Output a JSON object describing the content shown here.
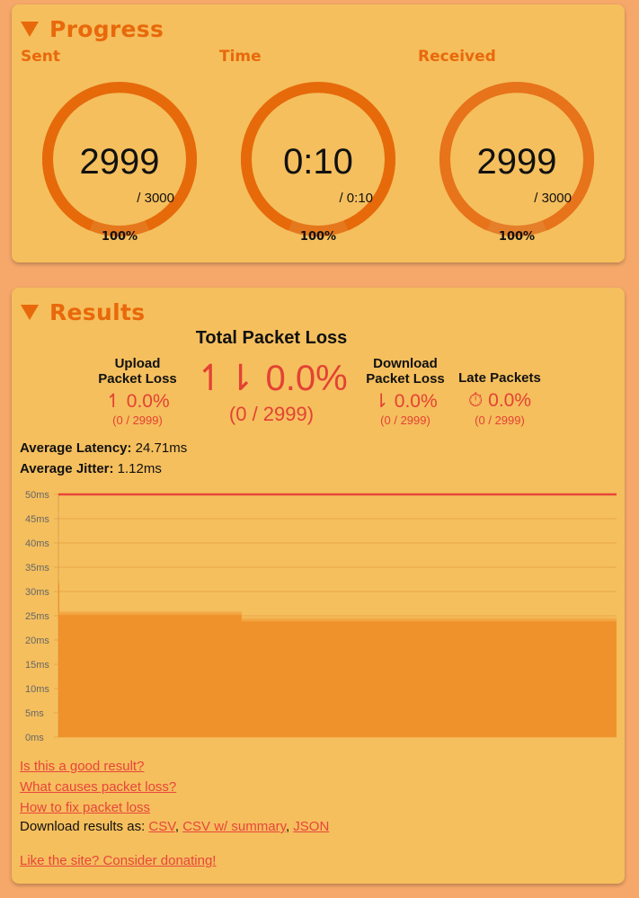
{
  "progress": {
    "title": "Progress",
    "gauges": [
      {
        "label": "Sent",
        "value": "2999",
        "total": "/ 3000",
        "percent": "100%",
        "fraction": 0.9997
      },
      {
        "label": "Time",
        "value": "0:10",
        "total": "/ 0:10",
        "percent": "100%",
        "fraction": 1.0
      },
      {
        "label": "Received",
        "value": "2999",
        "total": "/ 3000",
        "percent": "100%",
        "fraction": 0.9997
      }
    ]
  },
  "results": {
    "title": "Results",
    "total": {
      "title": "Total Packet Loss",
      "value": "↿⇂ 0.0%",
      "sub": "(0 / 2999)"
    },
    "upload": {
      "title1": "Upload",
      "title2": "Packet Loss",
      "value": "↿ 0.0%",
      "sub": "(0 / 2999)"
    },
    "download": {
      "title1": "Download",
      "title2": "Packet Loss",
      "value": "⇂ 0.0%",
      "sub": "(0 / 2999)"
    },
    "late": {
      "title": "Late Packets",
      "value": "⏱ 0.0%",
      "sub": "(0 / 2999)"
    },
    "latency_label": "Average Latency:",
    "latency_value": "24.71ms",
    "jitter_label": "Average Jitter:",
    "jitter_value": "1.12ms",
    "links": {
      "good_result": "Is this a good result?",
      "causes": "What causes packet loss?",
      "fix": "How to fix packet loss",
      "download_label": "Download results as:",
      "csv": "CSV",
      "csv_summary": "CSV w/ summary",
      "json": "JSON",
      "donate": "Like the site? Consider donating!"
    }
  },
  "colors": {
    "accent": "#e8690b",
    "loss": "#e34234",
    "bar": "#f0922b",
    "threshold": "#e8453c"
  },
  "chart_data": {
    "type": "area",
    "ylabel": "",
    "yticks": [
      "0ms",
      "5ms",
      "10ms",
      "15ms",
      "20ms",
      "25ms",
      "30ms",
      "35ms",
      "40ms",
      "45ms",
      "50ms"
    ],
    "ylim": [
      0,
      50
    ],
    "threshold_ms": 50,
    "packets": 2999,
    "segments": [
      {
        "from_packet": 0,
        "to_packet": 3,
        "latency_ms": 32
      },
      {
        "from_packet": 3,
        "to_packet": 985,
        "latency_ms": 25.5
      },
      {
        "from_packet": 985,
        "to_packet": 2999,
        "latency_ms": 24.2
      }
    ],
    "grid": true
  }
}
